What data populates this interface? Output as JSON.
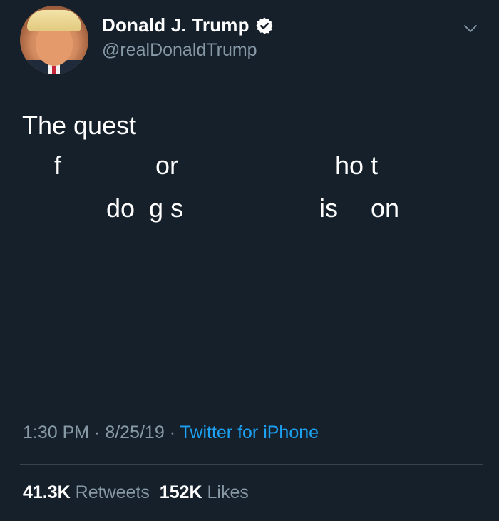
{
  "author": {
    "display_name": "Donald J. Trump",
    "handle": "@realDonaldTrump",
    "verified": true
  },
  "tweet": {
    "fragments": [
      "The quest",
      "f",
      "or",
      "ho t",
      "do  g s",
      "is",
      "on"
    ]
  },
  "meta": {
    "time": "1:30 PM",
    "separator": " · ",
    "date": "8/25/19",
    "source": "Twitter for iPhone"
  },
  "stats": {
    "retweets_count": "41.3K",
    "retweets_label": "Retweets",
    "likes_count": "152K",
    "likes_label": "Likes"
  },
  "colors": {
    "background": "#15202b",
    "primary_text": "#ffffff",
    "secondary_text": "#8899a6",
    "link": "#1da1f2",
    "divider": "#38444d"
  },
  "icons": {
    "verified": "verified-badge-icon",
    "menu": "chevron-down-icon"
  }
}
